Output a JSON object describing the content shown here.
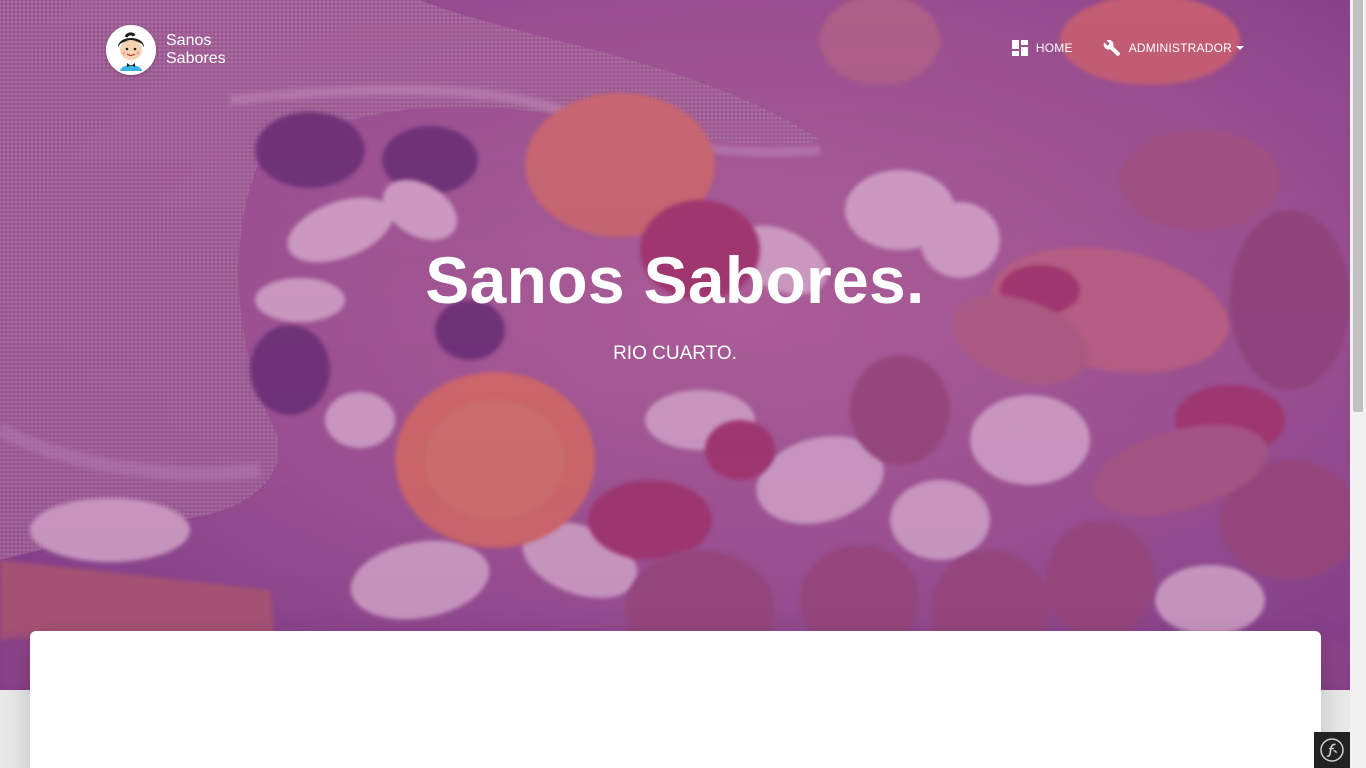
{
  "brand": {
    "line1": "Sanos",
    "line2": "Sabores",
    "logo_icon": "cartoon-boy-avatar-icon"
  },
  "nav": {
    "home": {
      "label": "HOME",
      "icon": "dashboard-icon"
    },
    "admin": {
      "label": "ADMINISTRADOR",
      "icon": "wrench-icon"
    }
  },
  "hero": {
    "title": "Sanos Sabores.",
    "subtitle": "RIO CUARTO.",
    "overlay_color": "#8e44ad",
    "background_image": "dried-fruits-and-nuts-in-burlap-sack"
  },
  "debug_toolbar": {
    "icon": "symfony-logo-icon"
  },
  "colors": {
    "text": "#ffffff",
    "card": "#ffffff",
    "page_bg": "#e9e9e9"
  }
}
